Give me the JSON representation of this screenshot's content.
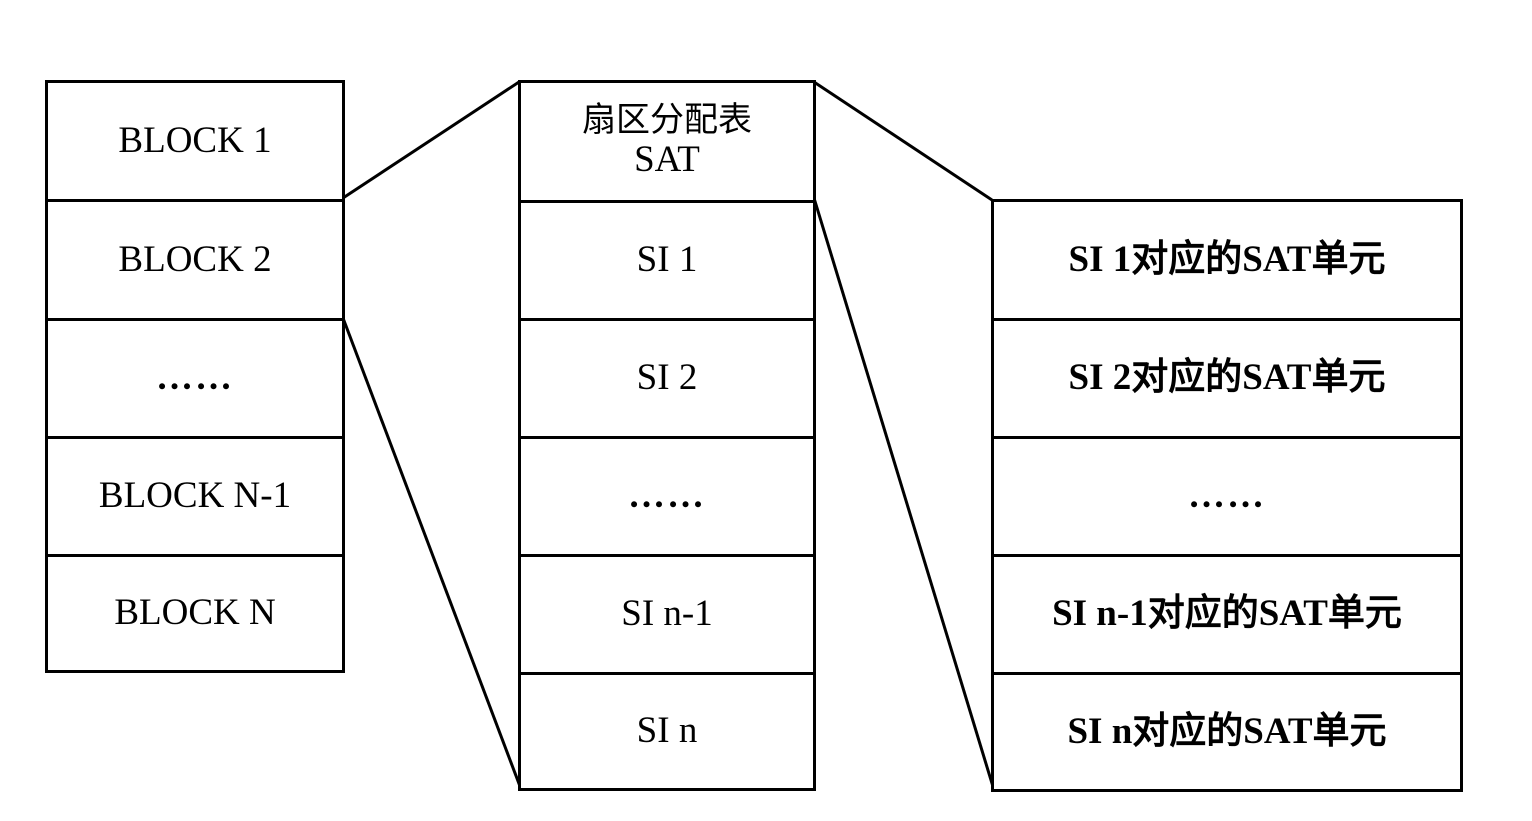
{
  "diagram": {
    "blocks_column": {
      "cells": [
        "BLOCK 1",
        "BLOCK 2",
        "……",
        "BLOCK N-1",
        "BLOCK N"
      ]
    },
    "sat_column": {
      "header_line1": "扇区分配表",
      "header_line2": "SAT",
      "cells": [
        "SI 1",
        "SI 2",
        "……",
        "SI n-1",
        "SI n"
      ]
    },
    "sat_units_column": {
      "cells": [
        "SI 1对应的SAT单元",
        "SI 2对应的SAT单元",
        "……",
        "SI n-1对应的SAT单元",
        "SI n对应的SAT单元"
      ]
    },
    "connections": [
      {
        "from": "BLOCK 1 / BLOCK 2 boundary",
        "to": "SAT column top"
      },
      {
        "from": "BLOCK 2 bottom",
        "to": "SAT column bottom"
      },
      {
        "from": "SAT header top",
        "to": "SAT units column top"
      },
      {
        "from": "SAT header bottom",
        "to": "SAT units column bottom"
      }
    ]
  }
}
